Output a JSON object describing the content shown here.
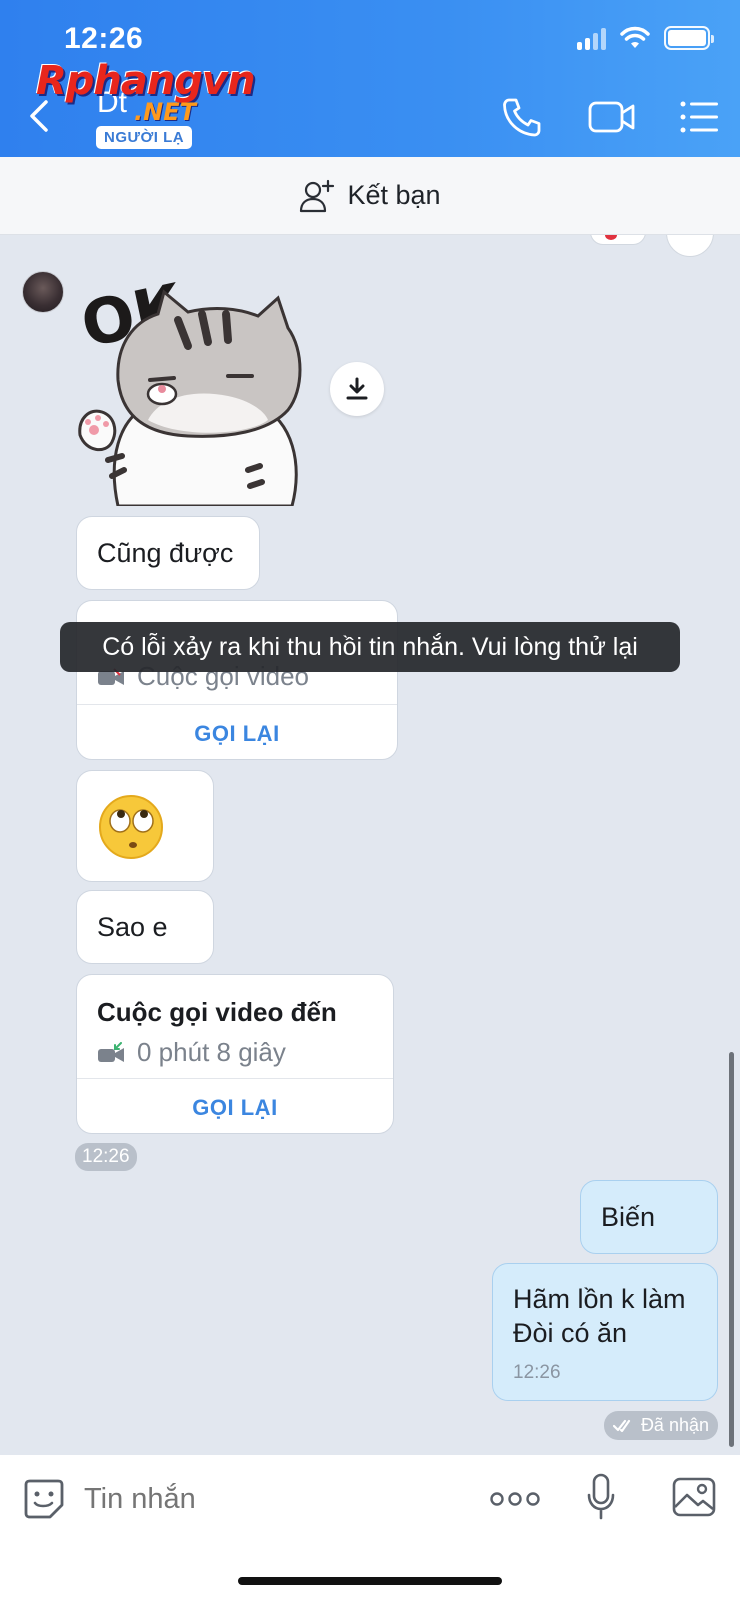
{
  "status_bar": {
    "time": "12:26"
  },
  "watermark": {
    "brand": "Rphangvn",
    "suffix": ".NET"
  },
  "header": {
    "contact_name": "Dt",
    "badge": "NGƯỜI LẠ"
  },
  "friend_bar": {
    "label": "Kết bạn"
  },
  "messages": {
    "text_1": "Cũng được",
    "call_1": {
      "subtitle": "Cuộc gọi video",
      "action": "GỌI LẠI"
    },
    "text_2": "Sao e",
    "call_2": {
      "title": "Cuộc gọi video đến",
      "subtitle": "0 phút 8 giây",
      "action": "GỌI LẠI"
    },
    "time_1": "12:26",
    "mine_1": "Biến",
    "mine_2_line1": "Hãm lồn k làm",
    "mine_2_line2": "Đòi có ăn",
    "mine_2_time": "12:26",
    "delivered": "Đã nhận"
  },
  "toast": "Có lỗi xảy ra khi thu hồi tin nhắn. Vui lòng thử lại",
  "composer": {
    "placeholder": "Tin nhắn"
  },
  "colors": {
    "header": "#3a8ff2",
    "accent": "#3b86e0",
    "mine_bubble": "#d5ecfb",
    "chat_bg": "#e2e7ef"
  },
  "icons": [
    "back-icon",
    "phone-icon",
    "video-icon",
    "menu-icon",
    "add-friend-icon",
    "download-icon",
    "sticker-icon",
    "more-icon",
    "mic-icon",
    "image-icon"
  ]
}
